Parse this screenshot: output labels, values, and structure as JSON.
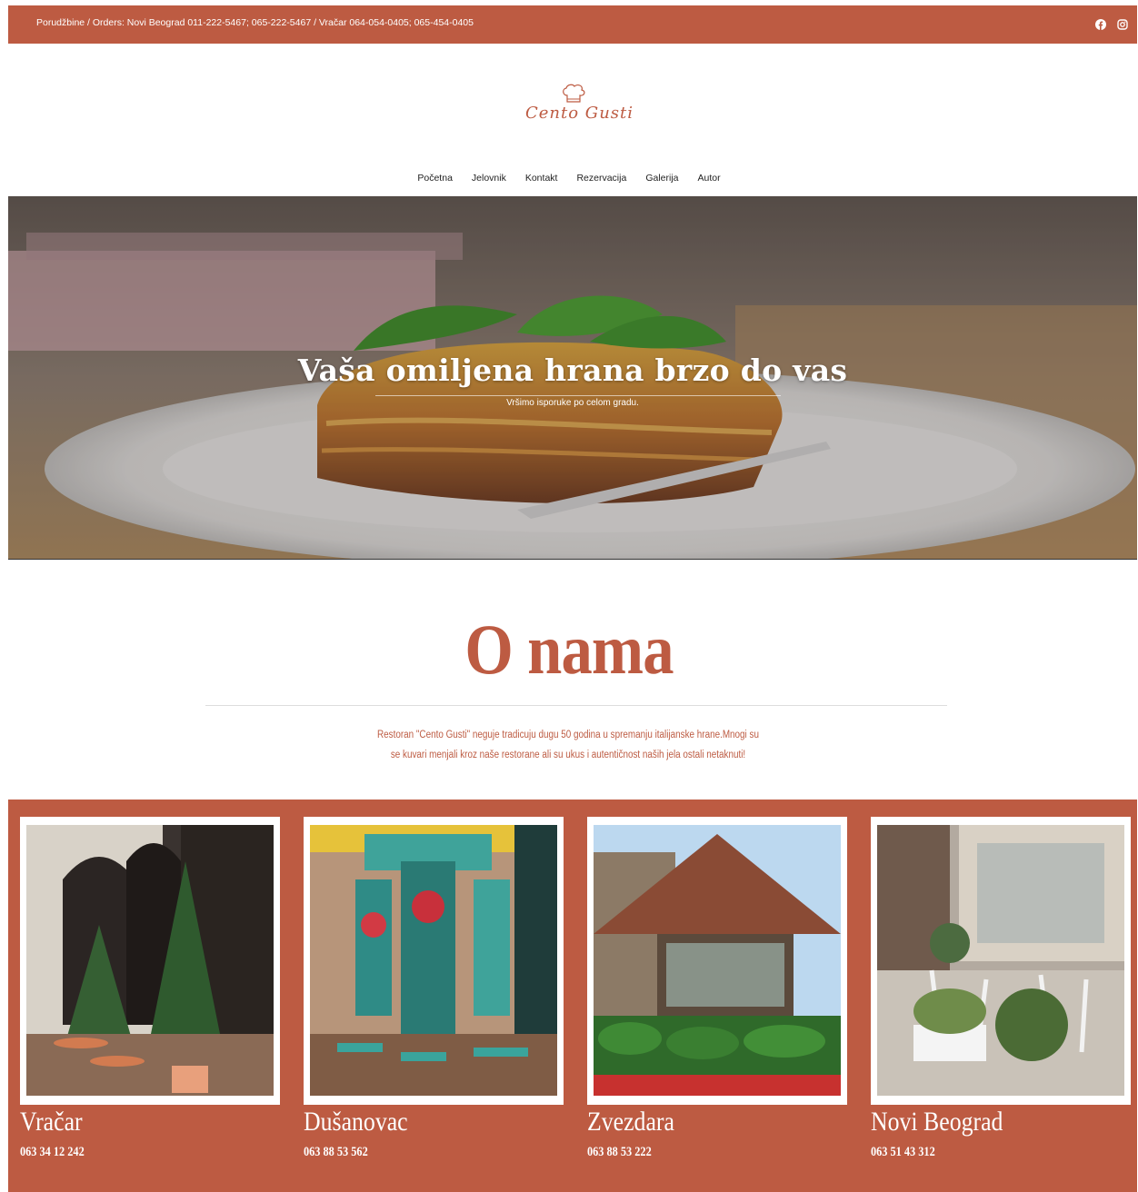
{
  "topbar": {
    "orders": "Porudžbine / Orders: Novi Beograd 011-222-5467; 065-222-5467 / Vračar 064-054-0405; 065-454-0405",
    "social": [
      "facebook-icon",
      "instagram-icon"
    ]
  },
  "logo": {
    "text": "Cento Gusti"
  },
  "nav": {
    "items": [
      "Početna",
      "Jelovnik",
      "Kontakt",
      "Rezervacija",
      "Galerija",
      "Autor"
    ]
  },
  "hero": {
    "title": "Vaša omiljena hrana brzo do vas",
    "subtitle": "Vršimo isporuke po celom gradu."
  },
  "about": {
    "title": "O nama",
    "text": "Restoran \"Cento Gusti\" neguje tradicuju dugu 50 godina u spremanju italijanske hrane.Mnogi su se kuvari menjali kroz naše restorane ali su ukus i autentičnost naših jela ostali netaknuti!"
  },
  "locations": [
    {
      "name": "Vračar",
      "phone": "063 34 12 242"
    },
    {
      "name": "Dušanovac",
      "phone": "063 88 53 562"
    },
    {
      "name": "Zvezdara",
      "phone": "063 88 53 222"
    },
    {
      "name": "Novi Beograd",
      "phone": "063 51 43 312"
    }
  ],
  "colors": {
    "accent": "#bd5b42",
    "white": "#ffffff"
  }
}
